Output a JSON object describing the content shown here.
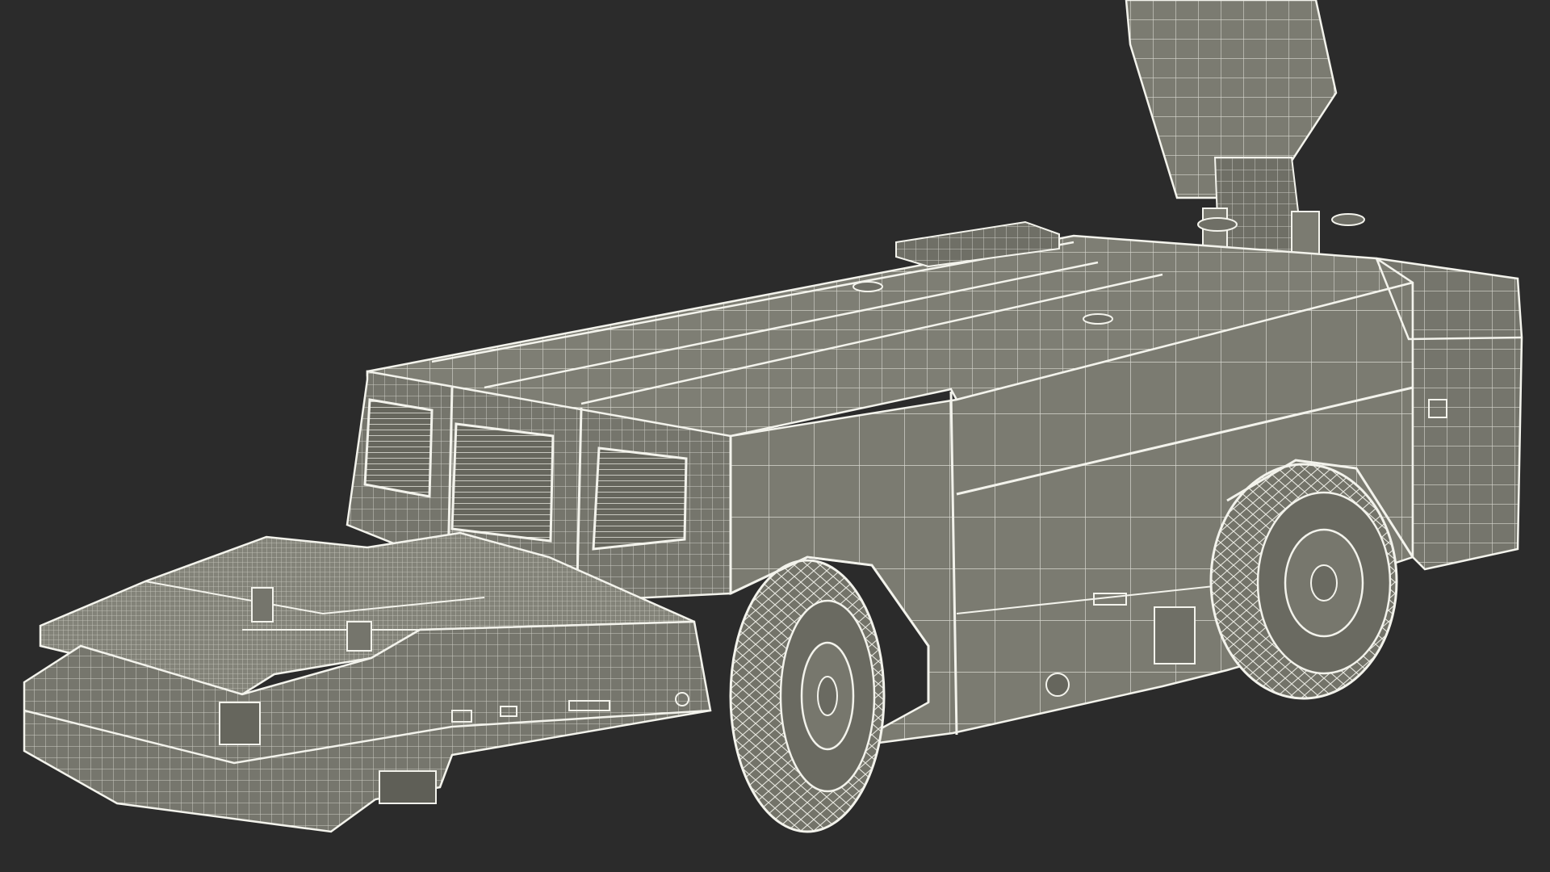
{
  "scene": {
    "background_color": "#2b2b2b",
    "model_color": "#7b7b71",
    "model_shadow_color": "#66665d",
    "wire_color": "#e9e9e1",
    "rendering_style": "wireframe-over-shaded"
  }
}
